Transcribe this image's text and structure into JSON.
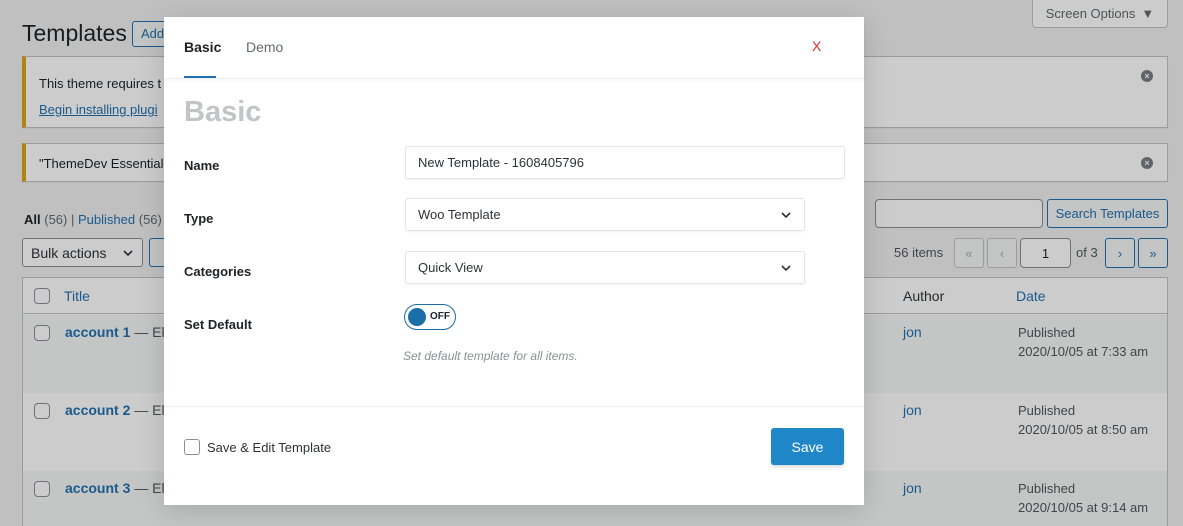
{
  "background": {
    "screen_options_label": "Screen Options",
    "page_title": "Templates",
    "add_new_label": "Add New",
    "notice_1": {
      "text": "This theme requires t",
      "link": "Begin installing plugi"
    },
    "notice_2": {
      "text": "\"ThemeDev Essential\""
    },
    "filters": {
      "all_label": "All",
      "all_count": "(56)",
      "separator": "|",
      "published_label": "Published",
      "published_count": "(56)"
    },
    "bulk_actions_label": "Bulk actions",
    "search_button_label": "Search Templates",
    "items_count": "56 items",
    "pagination": {
      "first": "«",
      "prev": "‹",
      "current": "1",
      "of": "of 3",
      "next": "›",
      "last": "»"
    },
    "columns": {
      "title": "Title",
      "author": "Author",
      "date": "Date"
    },
    "rows": [
      {
        "title": "account 1",
        "suffix": "— Ele",
        "author": "jon",
        "status": "Published",
        "date": "2020/10/05 at 7:33 am"
      },
      {
        "title": "account 2",
        "suffix": "— Ele",
        "author": "jon",
        "status": "Published",
        "date": "2020/10/05 at 8:50 am"
      },
      {
        "title": "account 3",
        "suffix": "— Ele",
        "author": "jon",
        "status": "Published",
        "date": "2020/10/05 at 9:14 am"
      }
    ]
  },
  "modal": {
    "tabs": [
      {
        "label": "Basic",
        "active": true
      },
      {
        "label": "Demo",
        "active": false
      }
    ],
    "close_label": "X",
    "section_title": "Basic",
    "fields": {
      "name": {
        "label": "Name",
        "value": "New Template - 1608405796"
      },
      "type": {
        "label": "Type",
        "value": "Woo Template"
      },
      "categories": {
        "label": "Categories",
        "value": "Quick View"
      },
      "set_default": {
        "label": "Set Default",
        "toggle_state": "OFF",
        "hint": "Set default template for all items."
      }
    },
    "footer": {
      "checkbox_label": "Save & Edit Template",
      "checkbox_checked": false,
      "save_label": "Save"
    }
  },
  "colors": {
    "accent": "#2271b1",
    "save_button": "#1f87c7",
    "toggle": "#1b6fa8",
    "close": "#e22d2d",
    "notice_border": "#dba617"
  }
}
